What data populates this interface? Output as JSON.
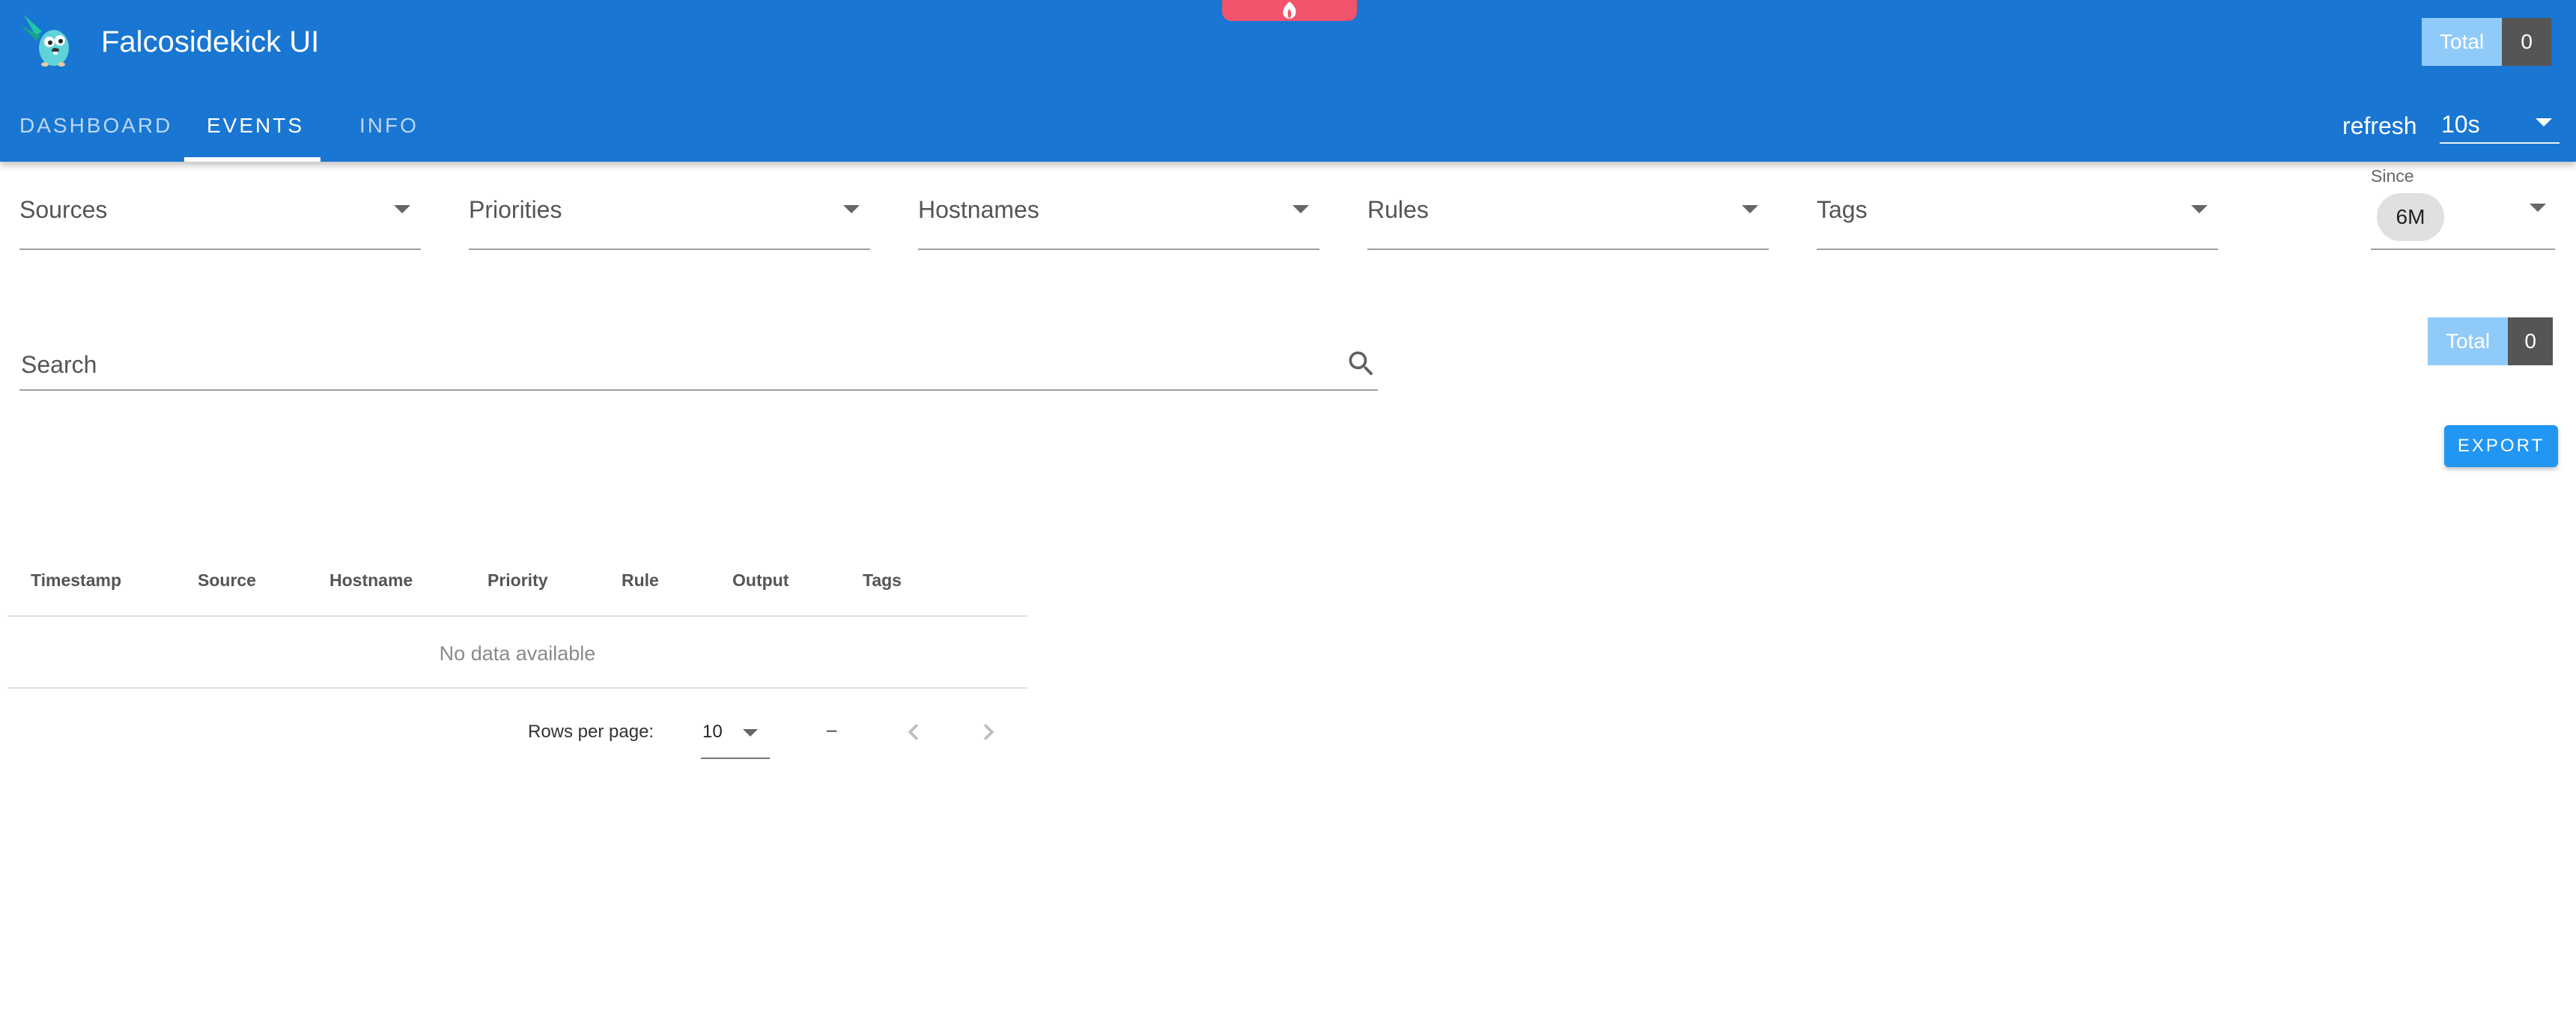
{
  "app": {
    "title": "Falcosidekick UI",
    "logo_icon": "falco-gopher-logo-icon",
    "top_tab_icon": "falco-flame-icon"
  },
  "header": {
    "total_label": "Total",
    "total_value": "0",
    "tabs": [
      {
        "label": "DASHBOARD",
        "active": false
      },
      {
        "label": "EVENTS",
        "active": true
      },
      {
        "label": "INFO",
        "active": false
      }
    ],
    "refresh_label": "refresh",
    "refresh_value": "10s"
  },
  "filters": {
    "sources": "Sources",
    "priorities": "Priorities",
    "hostnames": "Hostnames",
    "rules": "Rules",
    "tags": "Tags",
    "since_label": "Since",
    "since_value": "6M"
  },
  "search": {
    "placeholder": "Search",
    "value": ""
  },
  "summary": {
    "total_label": "Total",
    "total_value": "0",
    "export_label": "EXPORT"
  },
  "table": {
    "columns": [
      "Timestamp",
      "Source",
      "Hostname",
      "Priority",
      "Rule",
      "Output",
      "Tags"
    ],
    "empty_text": "No data available",
    "rows_per_page_label": "Rows per page:",
    "rows_per_page_value": "10",
    "range_text": "–"
  },
  "colors": {
    "primary": "#1976d2",
    "accent": "#2196f3",
    "tab_accent": "#f1546b",
    "total_label_bg": "#90caf9",
    "total_value_bg": "#555555"
  }
}
